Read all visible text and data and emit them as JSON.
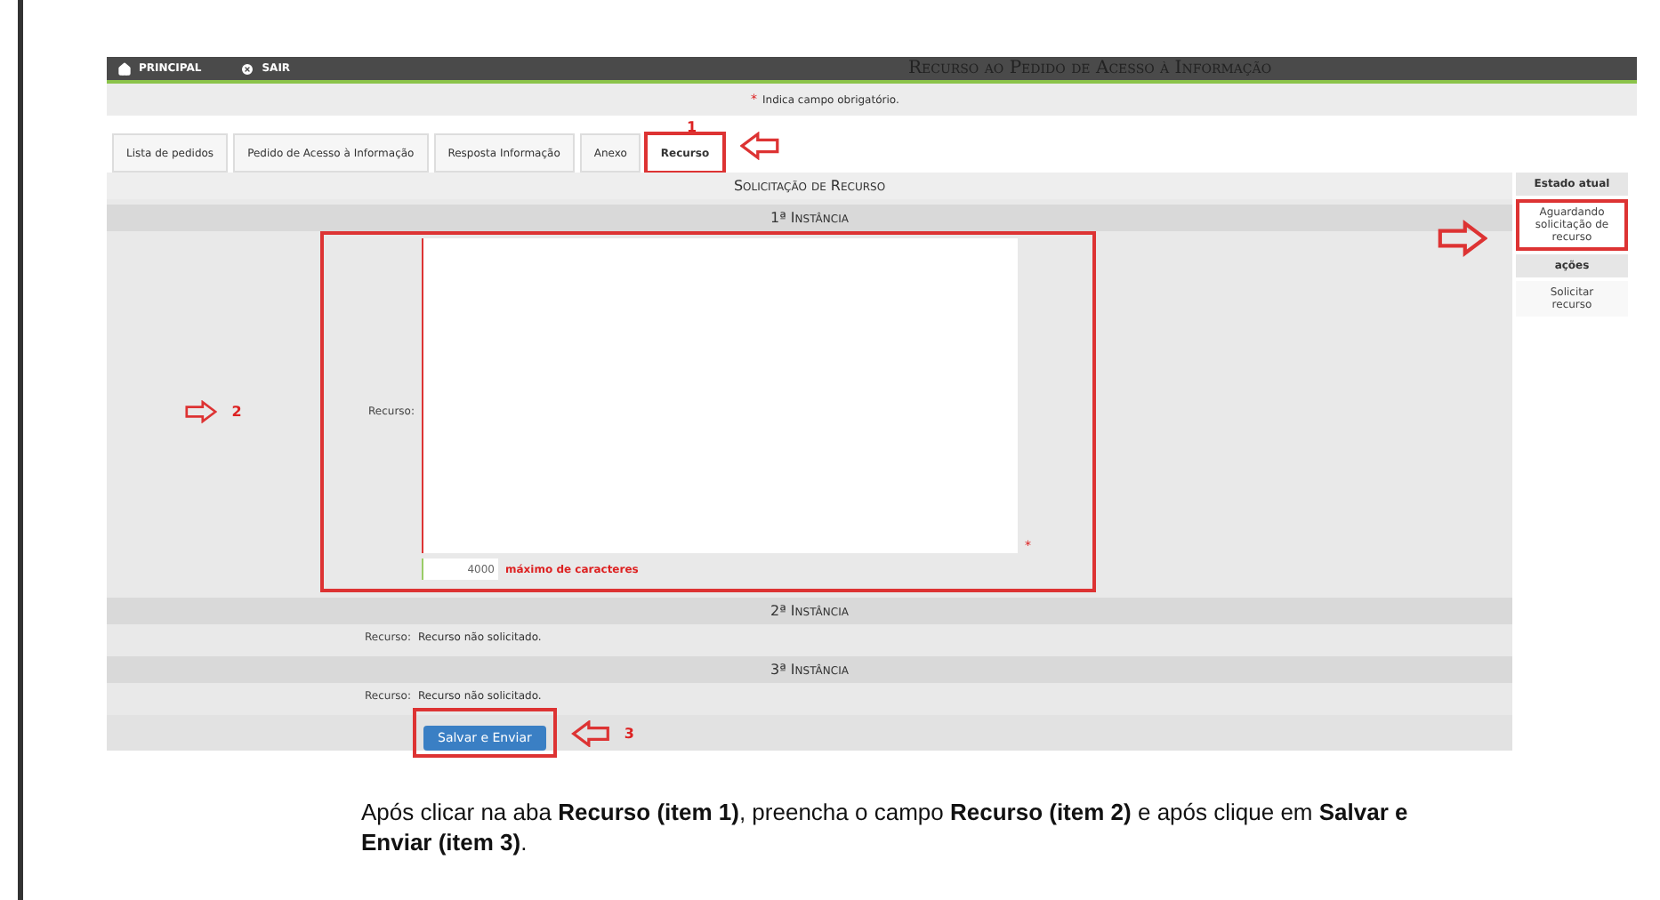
{
  "top_bar": {
    "nav": [
      {
        "label": "PRINCIPAL",
        "kind": "home"
      },
      {
        "label": "SAIR",
        "kind": "exit"
      }
    ],
    "title": "Recurso ao Pedido de Acesso à Informação"
  },
  "required_notice": {
    "mark": "*",
    "text": "Indica campo obrigatório."
  },
  "tabs": [
    {
      "label": "Lista de pedidos",
      "selected": false
    },
    {
      "label": "Pedido de Acesso à Informação",
      "selected": false
    },
    {
      "label": "Resposta Informação",
      "selected": false
    },
    {
      "label": "Anexo",
      "selected": false
    },
    {
      "label": "Recurso",
      "selected": true
    }
  ],
  "form": {
    "title": "Solicitação de Recurso",
    "instances": [
      {
        "heading": "1ª Instância",
        "kind": "input",
        "label": "Recurso:",
        "counter": "4000",
        "counter_hint": "máximo de caracteres",
        "required_mark": "*"
      },
      {
        "heading": "2ª Instância",
        "kind": "text",
        "label": "Recurso:",
        "value": "Recurso não solicitado."
      },
      {
        "heading": "3ª Instância",
        "kind": "text",
        "label": "Recurso:",
        "value": "Recurso não solicitado."
      }
    ],
    "submit": "Salvar e Enviar"
  },
  "sidebar": {
    "status_heading": "Estado atual",
    "status": "Aguardando solicitação de recurso",
    "actions_heading": "ações",
    "actions": [
      "Solicitar recurso"
    ]
  },
  "annotations": {
    "tab": "1",
    "field": "2",
    "button": "3"
  },
  "caption": "Após clicar na aba **Recurso (item 1)**, preencha o campo **Recurso (item 2)** e após clique em **Salvar e Enviar (item 3)**."
}
